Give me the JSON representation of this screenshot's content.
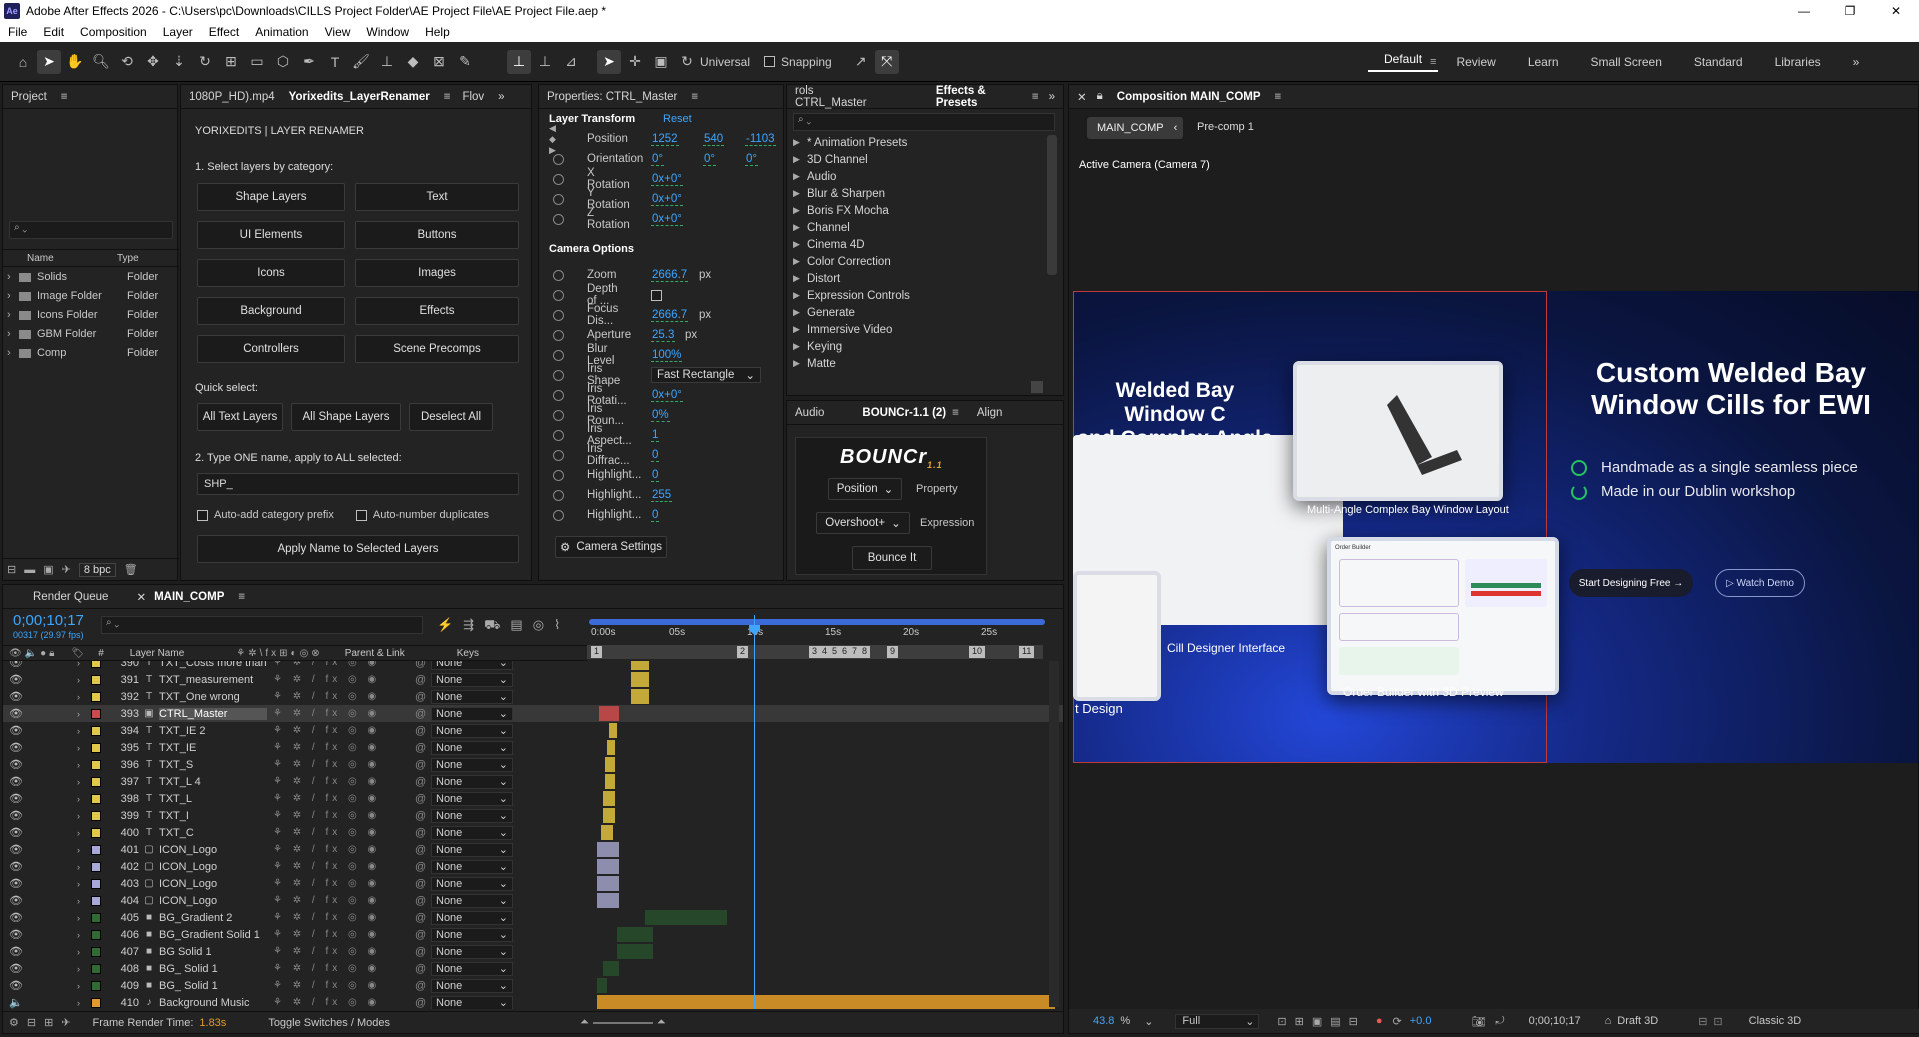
{
  "window": {
    "title": "Adobe After Effects 2026 - C:\\Users\\pc\\Downloads\\CILLS Project Folder\\AE Project File\\AE Project File.aep *",
    "logo": "Ae",
    "min": "—",
    "max": "❐",
    "close": "✕"
  },
  "menu": [
    "File",
    "Edit",
    "Composition",
    "Layer",
    "Effect",
    "Animation",
    "View",
    "Window",
    "Help"
  ],
  "toolbar": {
    "universal": "Universal",
    "snapping": "Snapping",
    "workspaces": [
      "Default",
      "Review",
      "Learn",
      "Small Screen",
      "Standard",
      "Libraries"
    ],
    "more": "»"
  },
  "project": {
    "title": "Project",
    "col_name": "Name",
    "col_type": "Type",
    "items": [
      {
        "name": "Solids",
        "type": "Folder"
      },
      {
        "name": "Image Folder",
        "type": "Folder"
      },
      {
        "name": "Icons Folder",
        "type": "Folder"
      },
      {
        "name": "GBM Folder",
        "type": "Folder"
      },
      {
        "name": "Comp",
        "type": "Folder"
      }
    ],
    "bpc": "8 bpc"
  },
  "renamer": {
    "tabs": [
      "1080P_HD).mp4",
      "Yorixedits_LayerRenamer",
      "Flov"
    ],
    "header": "YORIXEDITS | LAYER RENAMER",
    "step1": "1. Select layers by category:",
    "buttons": [
      "Shape Layers",
      "Text",
      "UI Elements",
      "Buttons",
      "Icons",
      "Images",
      "Background",
      "Effects",
      "Controllers",
      "Scene Precomps"
    ],
    "quick": "Quick select:",
    "quick_buttons": [
      "All Text Layers",
      "All Shape Layers",
      "Deselect All"
    ],
    "step2": "2. Type ONE name, apply to ALL selected:",
    "name_value": "SHP_",
    "opt1": "Auto-add category prefix",
    "opt2": "Auto-number duplicates",
    "apply": "Apply Name to Selected Layers"
  },
  "properties": {
    "title": "Properties: CTRL_Master",
    "section1": "Layer Transform",
    "reset": "Reset",
    "transform": [
      {
        "label": "Position",
        "vals": [
          "1252",
          "540",
          "-1103"
        ]
      },
      {
        "label": "Orientation",
        "vals": [
          "0°",
          "0°",
          "0°"
        ]
      },
      {
        "label": "X Rotation",
        "vals": [
          "0x+0°"
        ]
      },
      {
        "label": "Y Rotation",
        "vals": [
          "0x+0°"
        ]
      },
      {
        "label": "Z Rotation",
        "vals": [
          "0x+0°"
        ]
      }
    ],
    "section2": "Camera Options",
    "camera": [
      {
        "label": "Zoom",
        "val": "2666.7",
        "unit": "px"
      },
      {
        "label": "Depth of ...",
        "val": "",
        "unit": ""
      },
      {
        "label": "Focus Dis...",
        "val": "2666.7",
        "unit": "px"
      },
      {
        "label": "Aperture",
        "val": "25.3",
        "unit": "px"
      },
      {
        "label": "Blur Level",
        "val": "100%",
        "unit": ""
      },
      {
        "label": "Iris Shape",
        "val": "Fast Rectangle",
        "unit": ""
      },
      {
        "label": "Iris Rotati...",
        "val": "0x+0°",
        "unit": ""
      },
      {
        "label": "Iris Roun...",
        "val": "0%",
        "unit": ""
      },
      {
        "label": "Iris Aspect...",
        "val": "1",
        "unit": ""
      },
      {
        "label": "Iris Diffrac...",
        "val": "0",
        "unit": ""
      },
      {
        "label": "Highlight...",
        "val": "0",
        "unit": ""
      },
      {
        "label": "Highlight...",
        "val": "255",
        "unit": ""
      },
      {
        "label": "Highlight...",
        "val": "0",
        "unit": ""
      }
    ],
    "camera_settings": "Camera Settings"
  },
  "effects": {
    "tab_left": "rols CTRL_Master",
    "title": "Effects & Presets",
    "items": [
      "* Animation Presets",
      "3D Channel",
      "Audio",
      "Blur & Sharpen",
      "Boris FX Mocha",
      "Channel",
      "Cinema 4D",
      "Color Correction",
      "Distort",
      "Expression Controls",
      "Generate",
      "Immersive Video",
      "Keying",
      "Matte"
    ]
  },
  "bounce": {
    "tabs": [
      "Audio",
      "BOUNCr-1.1 (2)",
      "Align"
    ],
    "logo": "BOUNCr",
    "ver": "1.1",
    "property_select": "Position",
    "property_label": "Property",
    "expr_select": "Overshoot+",
    "expr_label": "Expression",
    "button": "Bounce It"
  },
  "comp": {
    "title": "Composition MAIN_COMP",
    "crumb1": "MAIN_COMP",
    "crumb2": "Pre-comp 1",
    "camera": "Active Camera (Camera 7)",
    "zoom": "43.8",
    "zoom_unit": "%",
    "resolution": "Full",
    "exposure": "+0.0",
    "timecode": "0;00;10;17",
    "renderer": "Draft 3D",
    "mode": "Classic 3D"
  },
  "art": {
    "left_heading1": "Welded Bay Window C",
    "left_heading2": "and Complex Angle",
    "heading1": "Custom Welded Bay",
    "heading2": "Window Cills for EWI",
    "bullet1": "Handmade as a single seamless piece",
    "bullet2": "Made in our Dublin workshop",
    "cta1": "Start Designing Free →",
    "cta2": "▷ Watch Demo",
    "cap1": "Multi-Angle Complex Bay Window Layout",
    "cap2": "Cill Designer Interface",
    "cap3": "Order Builder with 3D Preview",
    "cap4": "t Design",
    "card_title": "Order Builder"
  },
  "timeline": {
    "tabs": [
      "Render Queue",
      "MAIN_COMP"
    ],
    "timecode": "0;00;10;17",
    "fps": "00317 (29.97 fps)",
    "col_num": "#",
    "col_name": "Layer Name",
    "col_parent": "Parent & Link",
    "col_keys": "Keys",
    "ruler": [
      "0:00s",
      "05s",
      "10s",
      "15s",
      "20s",
      "25s"
    ],
    "markers": [
      "1",
      "2",
      "3",
      "4",
      "5",
      "6",
      "7",
      "8",
      "9",
      "10",
      "11"
    ],
    "layers": [
      {
        "n": "390",
        "type": "T",
        "name": "TXT_Costs more than",
        "color": "#e2c84a",
        "parent": "None"
      },
      {
        "n": "391",
        "type": "T",
        "name": "TXT_measurement",
        "color": "#e2c84a",
        "parent": "None"
      },
      {
        "n": "392",
        "type": "T",
        "name": "TXT_One wrong",
        "color": "#e2c84a",
        "parent": "None"
      },
      {
        "n": "393",
        "type": "cam",
        "name": "CTRL_Master",
        "color": "#c94b4b",
        "parent": "None"
      },
      {
        "n": "394",
        "type": "T",
        "name": "TXT_IE 2",
        "color": "#e2c84a",
        "parent": "None"
      },
      {
        "n": "395",
        "type": "T",
        "name": "TXT_IE",
        "color": "#e2c84a",
        "parent": "None"
      },
      {
        "n": "396",
        "type": "T",
        "name": "TXT_S",
        "color": "#e2c84a",
        "parent": "None"
      },
      {
        "n": "397",
        "type": "T",
        "name": "TXT_L 4",
        "color": "#e2c84a",
        "parent": "None"
      },
      {
        "n": "398",
        "type": "T",
        "name": "TXT_L",
        "color": "#e2c84a",
        "parent": "None"
      },
      {
        "n": "399",
        "type": "T",
        "name": "TXT_I",
        "color": "#e2c84a",
        "parent": "None"
      },
      {
        "n": "400",
        "type": "T",
        "name": "TXT_C",
        "color": "#e2c84a",
        "parent": "None"
      },
      {
        "n": "401",
        "type": "img",
        "name": "ICON_Logo",
        "color": "#a7a7d8",
        "parent": "None"
      },
      {
        "n": "402",
        "type": "img",
        "name": "ICON_Logo",
        "color": "#a7a7d8",
        "parent": "None"
      },
      {
        "n": "403",
        "type": "img",
        "name": "ICON_Logo",
        "color": "#a7a7d8",
        "parent": "None"
      },
      {
        "n": "404",
        "type": "img",
        "name": "ICON_Logo",
        "color": "#a7a7d8",
        "parent": "None"
      },
      {
        "n": "405",
        "type": "solid",
        "name": "BG_Gradient 2",
        "color": "#2f6b33",
        "parent": "None"
      },
      {
        "n": "406",
        "type": "solid",
        "name": "BG_Gradient Solid 1",
        "color": "#2f6b33",
        "parent": "None"
      },
      {
        "n": "407",
        "type": "solid",
        "name": "BG Solid 1",
        "color": "#2f6b33",
        "parent": "None"
      },
      {
        "n": "408",
        "type": "solid",
        "name": "BG_ Solid 1",
        "color": "#2f6b33",
        "parent": "None"
      },
      {
        "n": "409",
        "type": "solid",
        "name": "BG_ Solid 1",
        "color": "#2f6b33",
        "parent": "None"
      },
      {
        "n": "410",
        "type": "audio",
        "name": "Background Music",
        "color": "#e39a2c",
        "parent": "None"
      }
    ],
    "render_time_label": "Frame Render Time:",
    "render_time": "1.83s",
    "toggle": "Toggle Switches / Modes"
  }
}
